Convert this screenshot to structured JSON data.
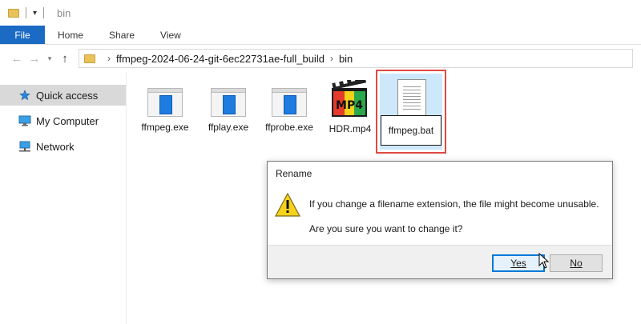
{
  "window": {
    "title": "bin"
  },
  "ribbon": {
    "tabs": [
      {
        "label": "File"
      },
      {
        "label": "Home"
      },
      {
        "label": "Share"
      },
      {
        "label": "View"
      }
    ]
  },
  "address": {
    "crumbs": [
      "ffmpeg-2024-06-24-git-6ec22731ae-full_build",
      "bin"
    ]
  },
  "sidebar": {
    "items": [
      {
        "label": "Quick access",
        "icon": "star-icon"
      },
      {
        "label": "My Computer",
        "icon": "computer-icon"
      },
      {
        "label": "Network",
        "icon": "network-icon"
      }
    ]
  },
  "files": [
    {
      "name": "ffmpeg.exe",
      "icon": "exe-icon"
    },
    {
      "name": "ffplay.exe",
      "icon": "exe-icon"
    },
    {
      "name": "ffprobe.exe",
      "icon": "exe-icon"
    },
    {
      "name": "HDR.mp4",
      "icon": "mp4-icon"
    },
    {
      "name": "ffmpeg.bat",
      "icon": "document-icon"
    }
  ],
  "dialog": {
    "title": "Rename",
    "message": "If you change a filename extension, the file might become unusable.",
    "question": "Are you sure you want to change it?",
    "yes_label": "Yes",
    "no_label": "No"
  },
  "colors": {
    "accent": "#1b6ac4",
    "selection": "#cde8fb",
    "highlight_border": "#e04a43",
    "default_button_border": "#0078d7"
  }
}
